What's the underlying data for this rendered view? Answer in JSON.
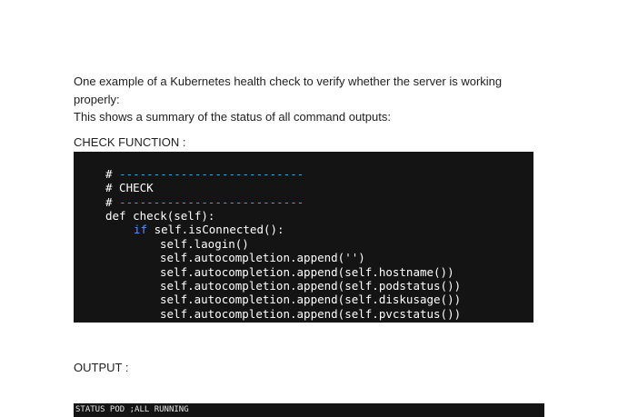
{
  "intro": {
    "line1": "One example of a Kubernetes health check to verify whether the server is working properly:",
    "line2": "This shows a summary of the status of all command outputs:"
  },
  "check_label": "CHECK FUNCTION  :",
  "code": {
    "comment_hash": "# ",
    "dash_rule": "---------------------------",
    "comment_check": "# CHECK",
    "def_line": "def check(self):",
    "if_kw": "if ",
    "if_rest": "self.isConnected():",
    "body": [
      "self.laogin()",
      "self.autocompletion.append('')",
      "self.autocompletion.append(self.hostname())",
      "self.autocompletion.append(self.podstatus())",
      "self.autocompletion.append(self.diskusage())",
      "self.autocompletion.append(self.pvcstatus())"
    ]
  },
  "output_label": "OUTPUT :",
  "output_text": "STATUS POD ;ALL RUNNING"
}
